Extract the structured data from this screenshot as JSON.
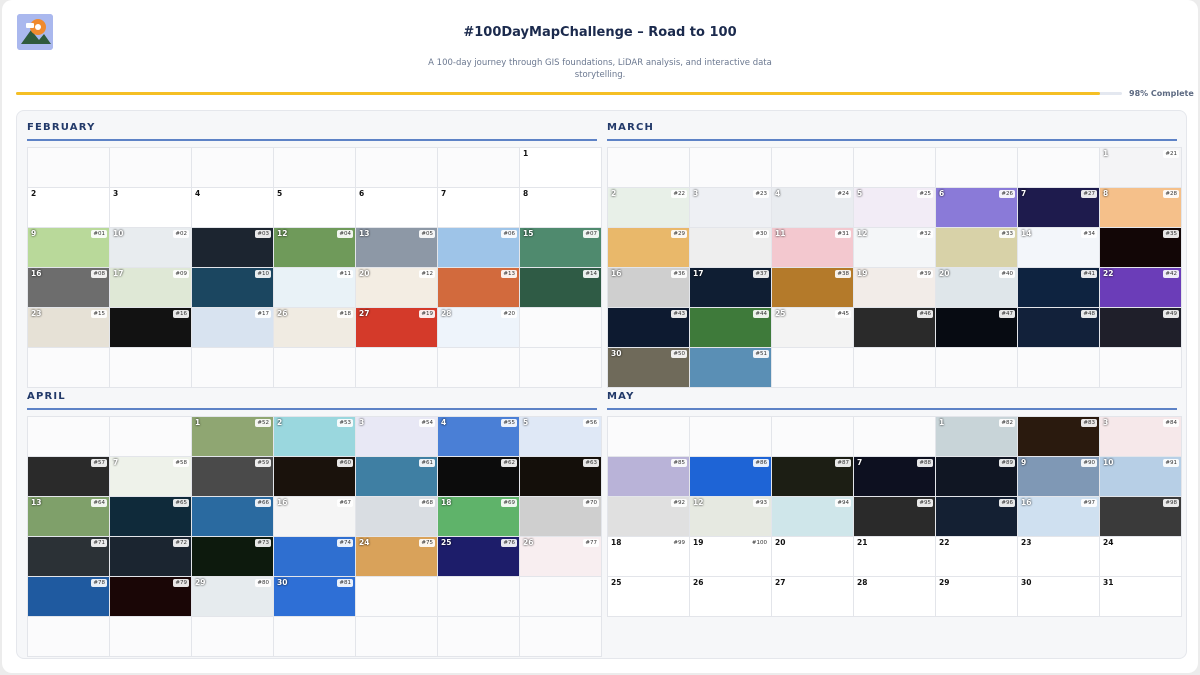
{
  "header": {
    "title": "#100DayMapChallenge – Road to 100",
    "subtitle": "A 100-day journey through GIS foundations, LiDAR analysis, and interactive data storytelling.",
    "progress_label": "98% Complete",
    "progress_fraction": 0.98
  },
  "colors": {
    "accent": "#f5bf24",
    "month_rule": "#5d82c6",
    "title": "#1b2a4d"
  },
  "months": [
    {
      "name": "FEBRUARY",
      "cells": [
        null,
        null,
        null,
        null,
        null,
        null,
        {
          "day": "1"
        },
        {
          "day": "2"
        },
        {
          "day": "3"
        },
        {
          "day": "4"
        },
        {
          "day": "5"
        },
        {
          "day": "6"
        },
        {
          "day": "7"
        },
        {
          "day": "8"
        },
        {
          "day": "9",
          "badge": "#01",
          "color": "#b9d99a"
        },
        {
          "day": "10",
          "badge": "#02",
          "color": "#e8ecef"
        },
        {
          "day": "",
          "badge": "#03",
          "color": "#1c2530"
        },
        {
          "day": "12",
          "badge": "#04",
          "color": "#6f9a5a"
        },
        {
          "day": "13",
          "badge": "#05",
          "color": "#8d98a6"
        },
        {
          "day": "",
          "badge": "#06",
          "color": "#9ec4e8"
        },
        {
          "day": "15",
          "badge": "#07",
          "color": "#4f8a6e"
        },
        {
          "day": "16",
          "badge": "#08",
          "color": "#6d6d6d"
        },
        {
          "day": "17",
          "badge": "#09",
          "color": "#dfe8d6"
        },
        {
          "day": "",
          "badge": "#10",
          "color": "#1b4660"
        },
        {
          "day": "",
          "badge": "#11",
          "color": "#e9f2f7"
        },
        {
          "day": "20",
          "badge": "#12",
          "color": "#f3ede3"
        },
        {
          "day": "",
          "badge": "#13",
          "color": "#d26a3d"
        },
        {
          "day": "",
          "badge": "#14",
          "color": "#2f5b45"
        },
        {
          "day": "23",
          "badge": "#15",
          "color": "#e6e1d6"
        },
        {
          "day": "",
          "badge": "#16",
          "color": "#121212"
        },
        {
          "day": "",
          "badge": "#17",
          "color": "#d8e3f0"
        },
        {
          "day": "26",
          "badge": "#18",
          "color": "#f0ebe2"
        },
        {
          "day": "27",
          "badge": "#19",
          "color": "#d43a2a"
        },
        {
          "day": "28",
          "badge": "#20",
          "color": "#eef4fb"
        },
        null,
        null,
        null,
        null,
        null,
        null,
        null,
        null
      ]
    },
    {
      "name": "MARCH",
      "cells": [
        null,
        null,
        null,
        null,
        null,
        null,
        {
          "day": "1",
          "badge": "#21",
          "color": "#f4f4f6"
        },
        {
          "day": "2",
          "badge": "#22",
          "color": "#e8f0e8"
        },
        {
          "day": "3",
          "badge": "#23",
          "color": "#eef0f4"
        },
        {
          "day": "4",
          "badge": "#24",
          "color": "#e9ecf0"
        },
        {
          "day": "5",
          "badge": "#25",
          "color": "#f2ecf6"
        },
        {
          "day": "6",
          "badge": "#26",
          "color": "#8a7ad8"
        },
        {
          "day": "7",
          "badge": "#27",
          "color": "#1e1b4d"
        },
        {
          "day": "8",
          "badge": "#28",
          "color": "#f5c08a"
        },
        {
          "day": "",
          "badge": "#29",
          "color": "#e9b86a"
        },
        {
          "day": "",
          "badge": "#30",
          "color": "#eeeeee"
        },
        {
          "day": "11",
          "badge": "#31",
          "color": "#f3c8cf"
        },
        {
          "day": "12",
          "badge": "#32",
          "color": "#f4f6f8"
        },
        {
          "day": "",
          "badge": "#33",
          "color": "#d8d2a8"
        },
        {
          "day": "14",
          "badge": "#34",
          "color": "#f3f6fa"
        },
        {
          "day": "",
          "badge": "#35",
          "color": "#120606"
        },
        {
          "day": "16",
          "badge": "#36",
          "color": "#cfcfcf"
        },
        {
          "day": "17",
          "badge": "#37",
          "color": "#0f1e33"
        },
        {
          "day": "",
          "badge": "#38",
          "color": "#b47a2a"
        },
        {
          "day": "19",
          "badge": "#39",
          "color": "#f2ece8"
        },
        {
          "day": "20",
          "badge": "#40",
          "color": "#dfe6ea"
        },
        {
          "day": "",
          "badge": "#41",
          "color": "#0e2340"
        },
        {
          "day": "22",
          "badge": "#42",
          "color": "#6b3db8"
        },
        {
          "day": "",
          "badge": "#43",
          "color": "#0d1a30"
        },
        {
          "day": "",
          "badge": "#44",
          "color": "#3e7a3a"
        },
        {
          "day": "25",
          "badge": "#45",
          "color": "#f3f3f3"
        },
        {
          "day": "",
          "badge": "#46",
          "color": "#2a2a2a"
        },
        {
          "day": "",
          "badge": "#47",
          "color": "#070b12"
        },
        {
          "day": "",
          "badge": "#48",
          "color": "#12213a"
        },
        {
          "day": "",
          "badge": "#49",
          "color": "#1f1f2a"
        },
        {
          "day": "30",
          "badge": "#50",
          "color": "#6f6a5a"
        },
        {
          "day": "",
          "badge": "#51",
          "color": "#5a8fb5"
        },
        null,
        null,
        null,
        null,
        null
      ]
    },
    {
      "name": "APRIL",
      "cells": [
        null,
        null,
        {
          "day": "1",
          "badge": "#52",
          "color": "#8fa672"
        },
        {
          "day": "2",
          "badge": "#53",
          "color": "#9ad7de"
        },
        {
          "day": "3",
          "badge": "#54",
          "color": "#e8e8f5"
        },
        {
          "day": "4",
          "badge": "#55",
          "color": "#4a7fd6"
        },
        {
          "day": "5",
          "badge": "#56",
          "color": "#dfe8f6"
        },
        {
          "day": "",
          "badge": "#57",
          "color": "#2a2a2a"
        },
        {
          "day": "7",
          "badge": "#58",
          "color": "#eef2ea"
        },
        {
          "day": "",
          "badge": "#59",
          "color": "#4a4a4a"
        },
        {
          "day": "",
          "badge": "#60",
          "color": "#1a120c"
        },
        {
          "day": "",
          "badge": "#61",
          "color": "#3f7fa3"
        },
        {
          "day": "",
          "badge": "#62",
          "color": "#0c0c0c"
        },
        {
          "day": "",
          "badge": "#63",
          "color": "#140f0a"
        },
        {
          "day": "13",
          "badge": "#64",
          "color": "#7fa06a"
        },
        {
          "day": "",
          "badge": "#65",
          "color": "#0f2a3a"
        },
        {
          "day": "",
          "badge": "#66",
          "color": "#2a6aa0"
        },
        {
          "day": "16",
          "badge": "#67",
          "color": "#f5f5f5"
        },
        {
          "day": "",
          "badge": "#68",
          "color": "#d9dde2"
        },
        {
          "day": "18",
          "badge": "#69",
          "color": "#5fb36a"
        },
        {
          "day": "",
          "badge": "#70",
          "color": "#cfcfcf"
        },
        {
          "day": "",
          "badge": "#71",
          "color": "#2b3136"
        },
        {
          "day": "",
          "badge": "#72",
          "color": "#1b2530"
        },
        {
          "day": "",
          "badge": "#73",
          "color": "#0d1a0d"
        },
        {
          "day": "",
          "badge": "#74",
          "color": "#2f6fd0"
        },
        {
          "day": "24",
          "badge": "#75",
          "color": "#d9a25a"
        },
        {
          "day": "25",
          "badge": "#76",
          "color": "#1d1d6a"
        },
        {
          "day": "26",
          "badge": "#77",
          "color": "#f8eef0"
        },
        {
          "day": "",
          "badge": "#78",
          "color": "#1f5aa0"
        },
        {
          "day": "",
          "badge": "#79",
          "color": "#1a0606"
        },
        {
          "day": "29",
          "badge": "#80",
          "color": "#e6ebee"
        },
        {
          "day": "30",
          "badge": "#81",
          "color": "#2e6fd6"
        },
        null,
        null,
        null,
        null,
        null,
        null,
        null,
        null,
        null,
        null
      ]
    },
    {
      "name": "MAY",
      "cells": [
        null,
        null,
        null,
        null,
        {
          "day": "1",
          "badge": "#82",
          "color": "#c8d4d8"
        },
        {
          "day": "",
          "badge": "#83",
          "color": "#2a1a0e"
        },
        {
          "day": "3",
          "badge": "#84",
          "color": "#f6e8ea"
        },
        {
          "day": "",
          "badge": "#85",
          "color": "#b9b3d8"
        },
        {
          "day": "",
          "badge": "#86",
          "color": "#1e64d6"
        },
        {
          "day": "",
          "badge": "#87",
          "color": "#1c1e14"
        },
        {
          "day": "7",
          "badge": "#88",
          "color": "#0d1020"
        },
        {
          "day": "",
          "badge": "#89",
          "color": "#101623"
        },
        {
          "day": "9",
          "badge": "#90",
          "color": "#7f98b5"
        },
        {
          "day": "10",
          "badge": "#91",
          "color": "#b7cfe6"
        },
        {
          "day": "",
          "badge": "#92",
          "color": "#e0e0e0"
        },
        {
          "day": "12",
          "badge": "#93",
          "color": "#e6e9e1"
        },
        {
          "day": "",
          "badge": "#94",
          "color": "#cfe6ea"
        },
        {
          "day": "",
          "badge": "#95",
          "color": "#2a2a2a"
        },
        {
          "day": "",
          "badge": "#96",
          "color": "#142033"
        },
        {
          "day": "16",
          "badge": "#97",
          "color": "#cfe0f0"
        },
        {
          "day": "",
          "badge": "#98",
          "color": "#3a3a3a"
        },
        {
          "day": "18",
          "badge": "#99"
        },
        {
          "day": "19",
          "badge": "#100"
        },
        {
          "day": "20"
        },
        {
          "day": "21"
        },
        {
          "day": "22"
        },
        {
          "day": "23"
        },
        {
          "day": "24"
        },
        {
          "day": "25"
        },
        {
          "day": "26"
        },
        {
          "day": "27"
        },
        {
          "day": "28"
        },
        {
          "day": "29"
        },
        {
          "day": "30"
        },
        {
          "day": "31"
        }
      ]
    }
  ]
}
